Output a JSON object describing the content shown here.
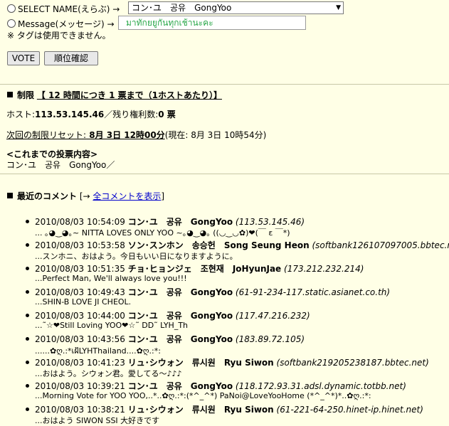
{
  "form": {
    "select_label": "SELECT NAME(えらぶ) →",
    "select_value": "コン･ユ　공유　GongYoo",
    "message_label": "Message(メッセージ) →",
    "message_value": "มาทักยยูกันทุกเช้านะคะ",
    "note": "※ タグは使用できません。",
    "vote_button": "VOTE",
    "ranking_button": "順位確認"
  },
  "limit": {
    "heading_prefix": "制限",
    "heading_rule": "【 12 時間につき 1 票まで（1ホストあたり）】",
    "host_label": "ホスト:",
    "host_value": "113.53.145.46",
    "remain_label": "／残り権利数:",
    "remain_value": "0 票",
    "reset_label": "次回の制限リセット:",
    "reset_value": " 8月 3日 12時00分",
    "current_time": "(現在: 8月 3日 10時54分)",
    "history_heading": "<これまでの投票内容>",
    "history_value": "コン･ユ　공유　GongYoo／"
  },
  "comments_section": {
    "heading": "最近のコメント",
    "link_prefix": "[→ ",
    "link_text": "全コメントを表示",
    "link_suffix": "]"
  },
  "comments": [
    {
      "time": "2010/08/03 10:54:09",
      "name": "コン･ユ　공유　GongYoo",
      "host": "(113.53.145.46)",
      "text": "... ｡◕‿◕｡~ NITTA LOVES ONLY YOO ~｡◕‿◕｡ ((◡‿◡✿)❤(￣ ε ￣*)"
    },
    {
      "time": "2010/08/03 10:53:58",
      "name": "ソン･スンホン　송승헌　Song Seung Heon",
      "host": "(softbank126107097005.bbtec.net)",
      "text": "...スンホニ、おはよう。今日もいい日になりますように。"
    },
    {
      "time": "2010/08/03 10:51:35",
      "name": "チョ･ヒョンジェ　조현재　JoHyunJae",
      "host": "(173.212.232.214)",
      "text": "...Perfect Man, We'll always love you!!!"
    },
    {
      "time": "2010/08/03 10:49:43",
      "name": "コン･ユ　공유　GongYoo",
      "host": "(61-91-234-117.static.asianet.co.th)",
      "text": "...SHIN-B LOVE JI CHEOL."
    },
    {
      "time": "2010/08/03 10:44:00",
      "name": "コン･ユ　공유　GongYoo",
      "host": "(117.47.216.232)",
      "text": "...˜☆❤Still Loving YOO❤☆˜ DD˜ LYH_Th"
    },
    {
      "time": "2010/08/03 10:43:56",
      "name": "コン･ユ　공유　GongYoo",
      "host": "(183.89.72.105)",
      "text": "......✿ღ.:*เฝ้LYHThailand....✿ღ.:*:"
    },
    {
      "time": "2010/08/03 10:41:23",
      "name": "リュ･シウォン　류시원　Ryu Siwon",
      "host": "(softbank219205238187.bbtec.net)",
      "text": "...おはよう。シウォン君。愛してる～♪♪♪"
    },
    {
      "time": "2010/08/03 10:39:21",
      "name": "コン･ユ　공유　GongYoo",
      "host": "(118.172.93.31.adsl.dynamic.totbb.net)",
      "text": "...Morning Vote for YOO YOO,..*..✿ღ.:*:(*^_^*) PaNoi@LoveYooHome (*^_^*)*..✿ღ.:*:"
    },
    {
      "time": "2010/08/03 10:38:21",
      "name": "リュ･シウォン　류시원　Ryu Siwon",
      "host": "(61-221-64-250.hinet-ip.hinet.net)",
      "text": "...おはよう SIWON SSI 大好きです"
    }
  ]
}
